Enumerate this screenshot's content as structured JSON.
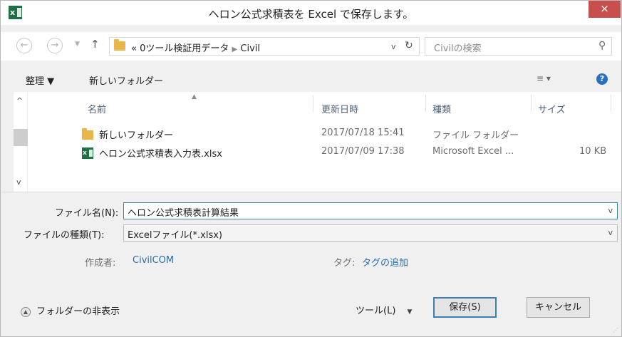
{
  "window": {
    "title": "ヘロン公式求積表を Excel で保存します。",
    "app_icon_text": "x",
    "close_glyph": "×"
  },
  "address": {
    "back_glyph": "←",
    "forward_glyph": "→",
    "up_glyph": "↑",
    "path_prefix": "«",
    "path_parent": "0ツール検証用データ",
    "path_sep": "▶",
    "path_current": "Civil",
    "dropdown_glyph": "v",
    "refresh_glyph": "↻",
    "search_placeholder": "Civilの検索",
    "search_glyph": "⚲"
  },
  "toolbar": {
    "organize": "整理 ▼",
    "new_folder": "新しいフォルダー",
    "view_glyph": "≡ ▾",
    "help_glyph": "?"
  },
  "file_list": {
    "columns": {
      "name": "名前",
      "modified": "更新日時",
      "type": "種類",
      "size": "サイズ"
    },
    "scroll_up_glyph": "^",
    "scroll_down_glyph": "v",
    "sort_glyph": "▲",
    "rows": [
      {
        "name": "新しいフォルダー",
        "modified": "2017/07/18 15:41",
        "type": "ファイル フォルダー",
        "size": ""
      },
      {
        "name": "ヘロン公式求積表入力表.xlsx",
        "modified": "2017/07/09 17:38",
        "type": "Microsoft Excel ...",
        "size": "10 KB"
      }
    ]
  },
  "form": {
    "filename_label": "ファイル名(N):",
    "filename_value": "ヘロン公式求積表計算結果",
    "filetype_label": "ファイルの種類(T):",
    "filetype_value": "Excelファイル(*.xlsx)",
    "dd_glyph": "v",
    "author_label": "作成者:",
    "author_value": "CivilCOM",
    "tags_label": "タグ:",
    "tags_value": "タグの追加"
  },
  "footer": {
    "hide_folders": "フォルダーの非表示",
    "hide_glyph": "▲",
    "tools": "ツール(L)",
    "tools_arrow": "▼",
    "save": "保存(S)",
    "cancel": "キャンセル",
    "grip": "⋰"
  }
}
